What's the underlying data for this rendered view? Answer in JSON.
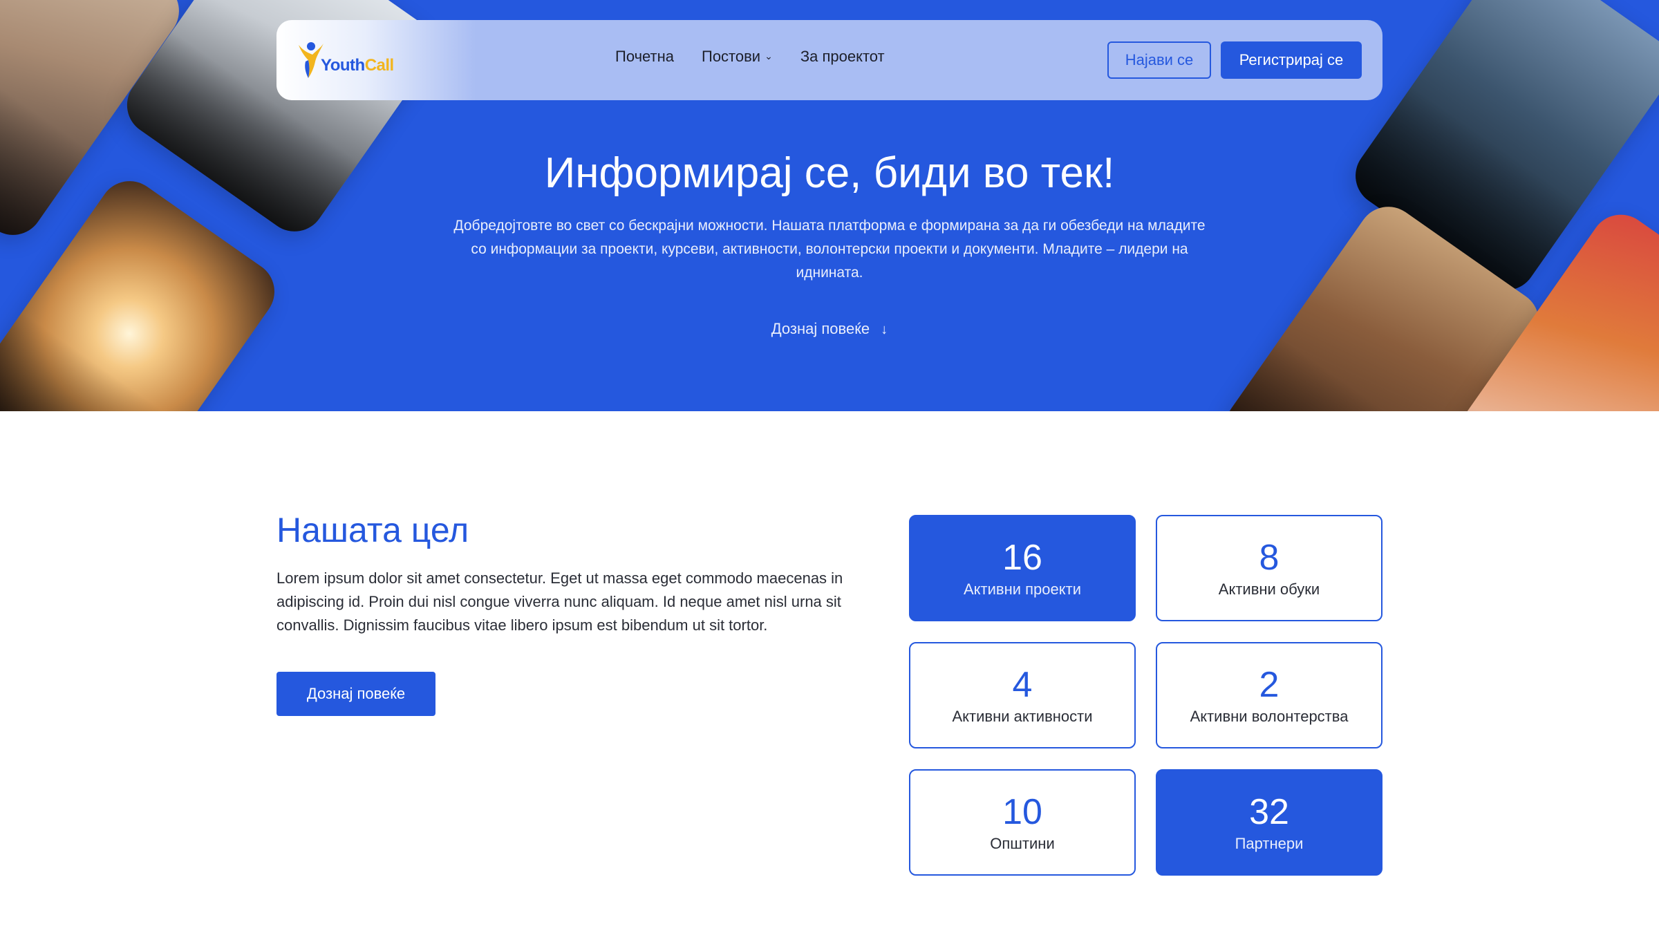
{
  "colors": {
    "brand": "#2558de",
    "accent": "#f2b51e",
    "white": "#ffffff"
  },
  "logo": {
    "word1": "Youth",
    "word2": "Call"
  },
  "nav": {
    "items": [
      {
        "label": "Почетна"
      },
      {
        "label": "Постови",
        "has_dropdown": true
      },
      {
        "label": "За проектот"
      }
    ],
    "login_label": "Најави се",
    "register_label": "Регистрирај се"
  },
  "hero": {
    "title": "Информирај се, биди во тек!",
    "text": "Добредојтовте во свет со бескрајни можности. Нашата платформа е формирана за да ги обезбеди на младите со информации за проекти, курсеви, активности, волонтерски проекти и документи. Младите – лидери на иднината.",
    "more_label": "Дознај повеќе",
    "more_icon": "arrow-down-icon"
  },
  "goal": {
    "title": "Нашата цел",
    "text": "Lorem ipsum dolor sit amet consectetur. Eget ut massa eget commodo maecenas in adipiscing id. Proin dui nisl congue viverra nunc aliquam. Id neque amet nisl urna sit convallis. Dignissim faucibus vitae libero ipsum est bibendum ut sit tortor.",
    "button_label": "Дознај повеќе"
  },
  "stats": [
    {
      "value": "16",
      "label": "Активни проекти",
      "filled": true
    },
    {
      "value": "8",
      "label": "Активни обуки",
      "filled": false
    },
    {
      "value": "4",
      "label": "Активни активности",
      "filled": false
    },
    {
      "value": "2",
      "label": "Активни волонтерства",
      "filled": false
    },
    {
      "value": "10",
      "label": "Општини",
      "filled": false
    },
    {
      "value": "32",
      "label": "Партнери",
      "filled": true
    }
  ]
}
